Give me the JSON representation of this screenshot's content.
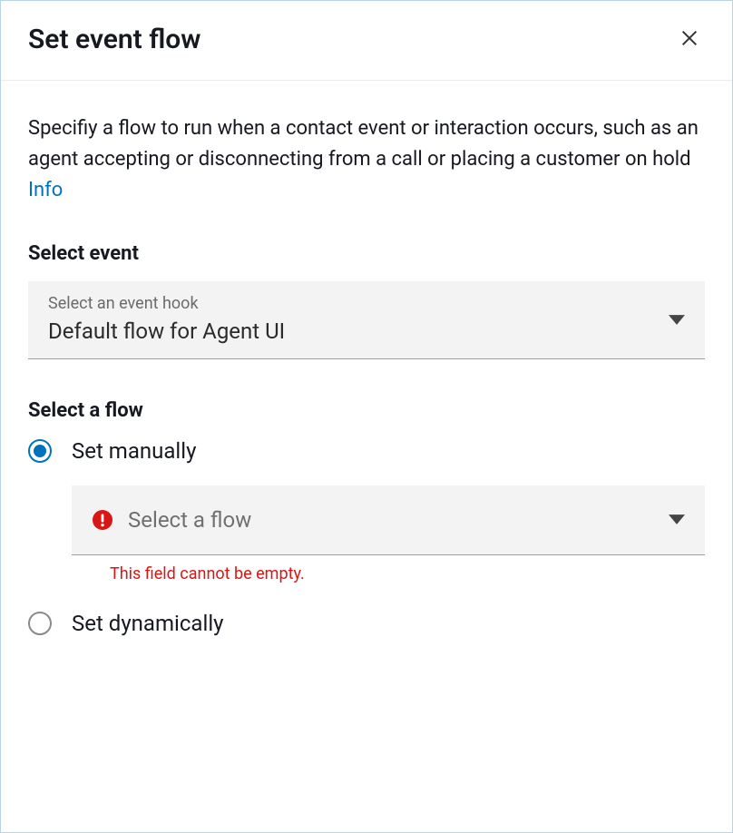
{
  "header": {
    "title": "Set event flow"
  },
  "description": {
    "text": "Specifiy a flow to run when a contact event or interaction occurs, such as an agent accepting or disconnecting from a call or placing a customer on hold ",
    "info_link": "Info"
  },
  "event_section": {
    "label": "Select event",
    "dropdown_small_label": "Select an event hook",
    "dropdown_value": "Default flow for Agent UI"
  },
  "flow_section": {
    "label": "Select a flow",
    "options": {
      "manual": "Set manually",
      "dynamic": "Set dynamically"
    },
    "flow_dropdown_placeholder": "Select a flow",
    "error_message": "This field cannot be empty."
  }
}
